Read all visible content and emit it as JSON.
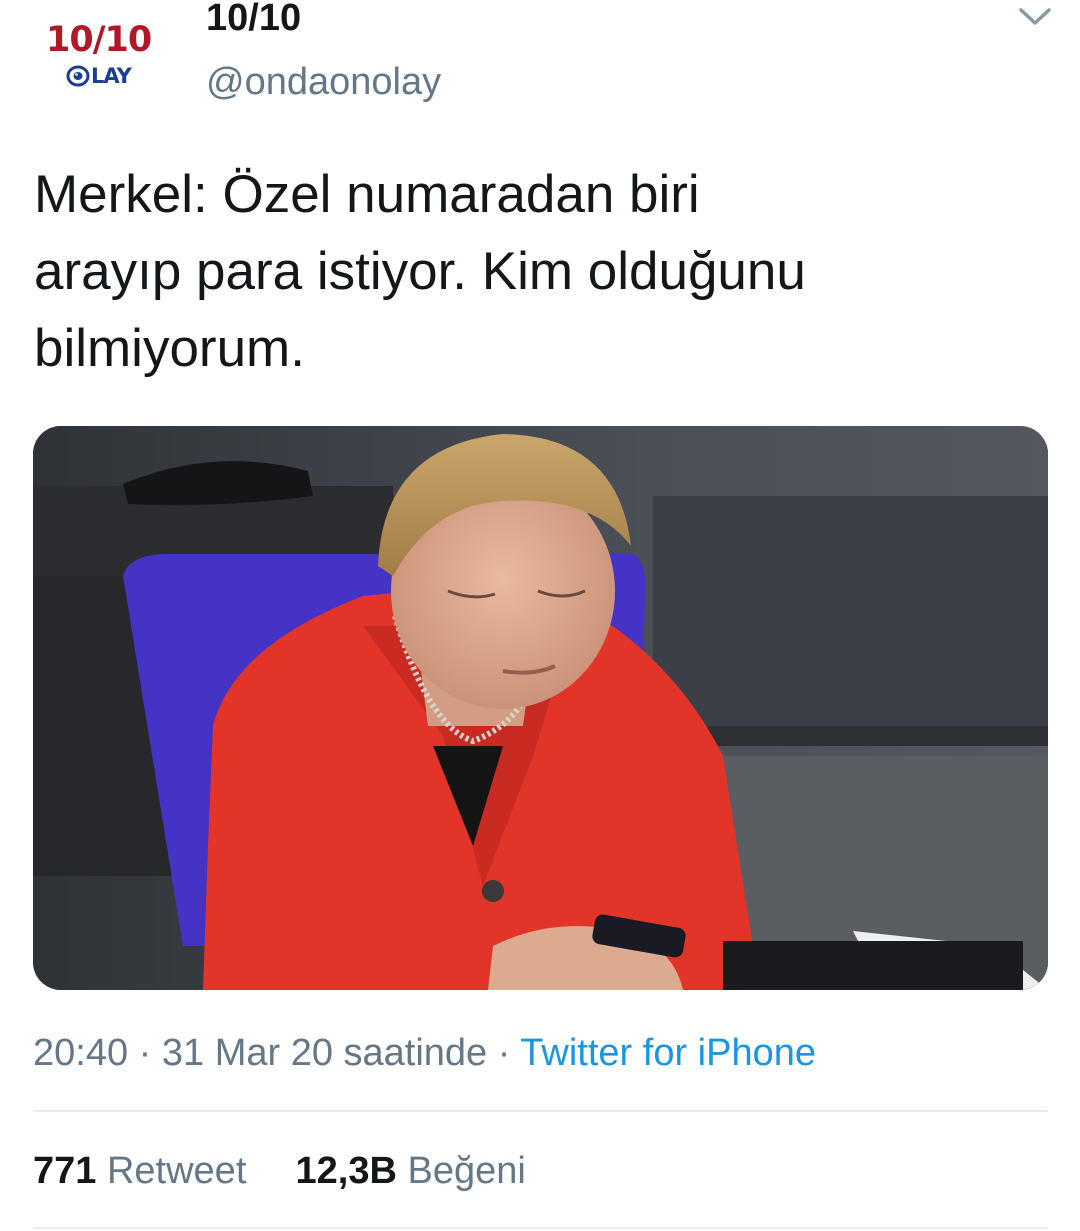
{
  "account": {
    "display_name": "10/10",
    "handle": "@ondaonolay",
    "avatar": {
      "logo_top": "10/10",
      "logo_bottom": "LAY",
      "logo_top_color": "#b0182a",
      "logo_bottom_color": "#1b3f8f"
    },
    "menu_icon": "chevron-down-icon"
  },
  "tweet": {
    "text": "Merkel: Özel numaradan biri\narayıp para istiyor. Kim olduğunu\nbilmiyorum.",
    "time": "20:40",
    "separator": "·",
    "date": "31 Mar 20 saatinde",
    "source": "Twitter for iPhone"
  },
  "stats": {
    "retweets_count": "771",
    "retweets_label": "Retweet",
    "likes_count": "12,3B",
    "likes_label": "Beğeni"
  },
  "colors": {
    "text_primary": "#14171a",
    "text_secondary": "#657786",
    "link": "#1b95e0",
    "divider": "#e6ecf0"
  }
}
